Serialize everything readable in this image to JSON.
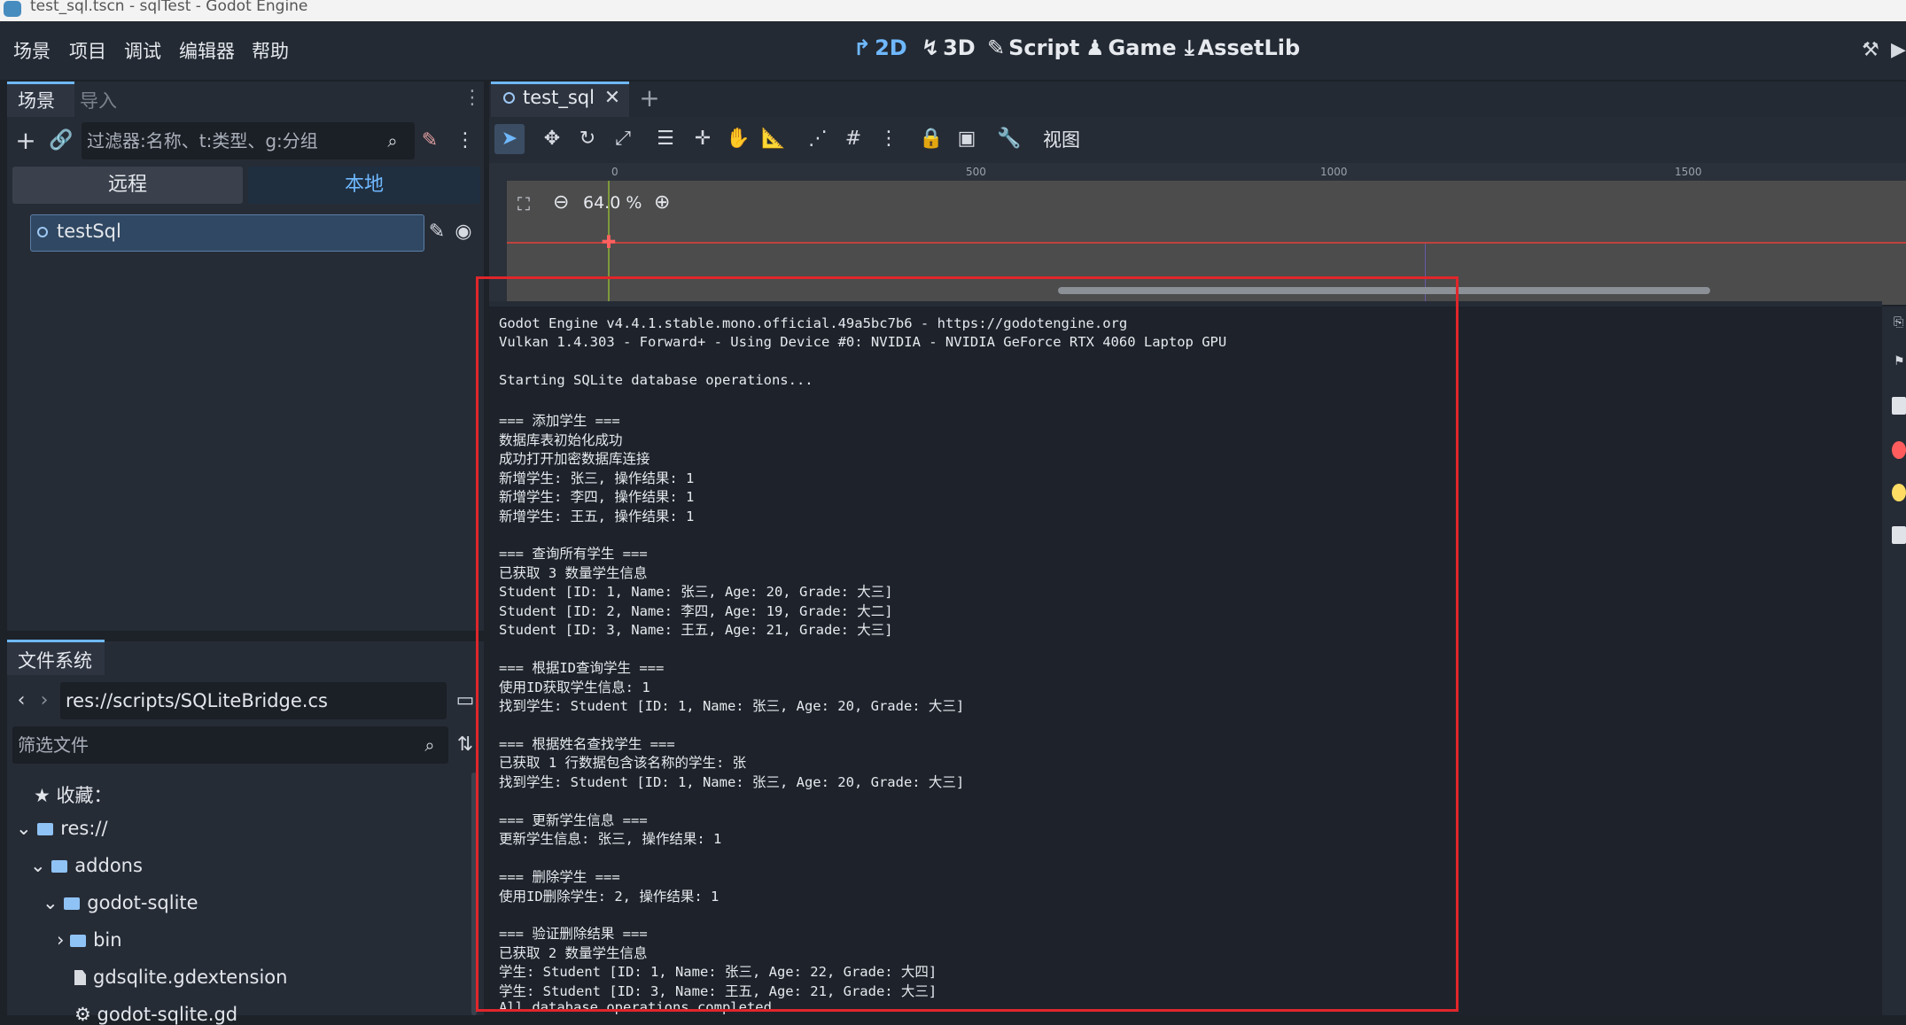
{
  "window": {
    "title": "test_sql.tscn - sqlTest - Godot Engine"
  },
  "menu": [
    "场景",
    "项目",
    "调试",
    "编辑器",
    "帮助"
  ],
  "workspaces": [
    {
      "icon": "↱",
      "label": "2D",
      "active": true
    },
    {
      "icon": "↯",
      "label": "3D",
      "active": false
    },
    {
      "icon": "✎",
      "label": "Script",
      "active": false
    },
    {
      "icon": "♟",
      "label": "Game",
      "active": false
    },
    {
      "icon": "⤓",
      "label": "AssetLib",
      "active": false
    }
  ],
  "scene_dock": {
    "tabs": [
      "场景",
      "导入"
    ],
    "filter_placeholder": "过滤器:名称、t:类型、g:分组",
    "segments": [
      "远程",
      "本地"
    ],
    "root_node": "testSql"
  },
  "filesystem": {
    "tab": "文件系统",
    "path": "res://scripts/SQLiteBridge.cs",
    "filter_placeholder": "筛选文件",
    "favorites": "收藏：",
    "tree": [
      "res://",
      "addons",
      "godot-sqlite",
      "bin",
      "gdsqlite.gdextension",
      "godot-sqlite.gd"
    ]
  },
  "editor": {
    "scene_tab": "test_sql",
    "view_menu": "视图",
    "zoom": "64.0 %",
    "ruler": [
      "0",
      "500",
      "1000",
      "1500"
    ]
  },
  "output": {
    "lines": [
      "Godot Engine v4.4.1.stable.mono.official.49a5bc7b6 - https://godotengine.org",
      "Vulkan 1.4.303 - Forward+ - Using Device #0: NVIDIA - NVIDIA GeForce RTX 4060 Laptop GPU",
      "",
      "Starting SQLite database operations...",
      "",
      "=== 添加学生 ===",
      "数据库表初始化成功",
      "成功打开加密数据库连接",
      "新增学生: 张三, 操作结果: 1",
      "新增学生: 李四, 操作结果: 1",
      "新增学生: 王五, 操作结果: 1",
      "",
      "=== 查询所有学生 ===",
      "已获取 3 数量学生信息",
      "Student [ID: 1, Name: 张三, Age: 20, Grade: 大三]",
      "Student [ID: 2, Name: 李四, Age: 19, Grade: 大二]",
      "Student [ID: 3, Name: 王五, Age: 21, Grade: 大三]",
      "",
      "=== 根据ID查询学生 ===",
      "使用ID获取学生信息: 1",
      "找到学生: Student [ID: 1, Name: 张三, Age: 20, Grade: 大三]",
      "",
      "=== 根据姓名查找学生 ===",
      "已获取 1 行数据包含该名称的学生: 张",
      "找到学生: Student [ID: 1, Name: 张三, Age: 20, Grade: 大三]",
      "",
      "=== 更新学生信息 ===",
      "更新学生信息: 张三, 操作结果: 1",
      "",
      "=== 删除学生 ===",
      "使用ID删除学生: 2, 操作结果: 1",
      "",
      "=== 验证删除结果 ===",
      "已获取 2 数量学生信息",
      "学生: Student [ID: 1, Name: 张三, Age: 22, Grade: 大四]",
      "学生: Student [ID: 3, Name: 王五, Age: 21, Grade: 大三]",
      "All database operations completed"
    ]
  },
  "colors": {
    "accent": "#6fb8ff",
    "highlight_box": "#e0262b"
  }
}
